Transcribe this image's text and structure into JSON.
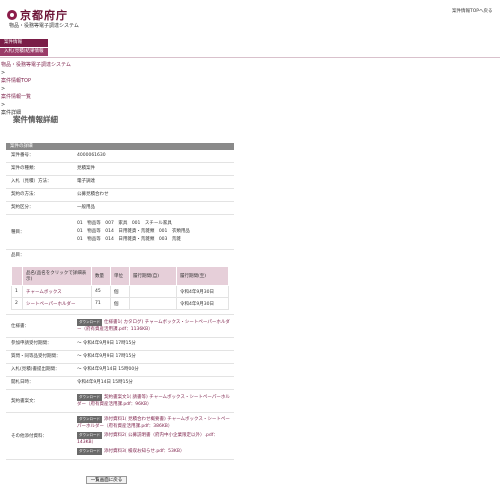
{
  "header": {
    "logo": "京都府庁",
    "subtitle": "物品・役務等電子調達システム",
    "top_link": "案件情報TOPへ戻る"
  },
  "nav": {
    "items": [
      "案件情報",
      "入札(見積)結果情報"
    ]
  },
  "breadcrumbs": {
    "system": "物品・役務等電子調達システム",
    "sep": ">",
    "top": "案件情報TOP",
    "list": "案件情報一覧",
    "current": "案件詳細"
  },
  "page_title": "案件情報詳細",
  "section_title": "案件の詳細",
  "fields": {
    "number": {
      "label": "案件番号：",
      "value": "4000061630"
    },
    "type": {
      "label": "案件の種類：",
      "value": "見積案件"
    },
    "method": {
      "label": "入札（見積）方法：",
      "value": "電子調達"
    },
    "contract": {
      "label": "契約の方法：",
      "value": "公募見積合わせ"
    },
    "category": {
      "label": "契約区分：",
      "value": "一般用品"
    },
    "kind": {
      "label": "種目：",
      "values": [
        "01　物品等　007　家具　001　スチール家具",
        "01　物品等　014　日用雑貨・荒雑類　001　衣類用品",
        "01　物品等　014　日用雑貨・荒雑類　003　荒雑"
      ]
    },
    "items_label": "品目："
  },
  "items_table": {
    "headers": [
      "",
      "品名(品名をクリックで詳細表示)",
      "数量",
      "単位",
      "履行期間(自)",
      "履行期間(至)"
    ],
    "rows": [
      [
        "1",
        "チャームボックス",
        "45",
        "個",
        "",
        "令和4年9月30日"
      ],
      [
        "2",
        "シートペーパーホルダー",
        "71",
        "個",
        "",
        "令和4年9月30日"
      ]
    ]
  },
  "spec": {
    "label": "仕様書：",
    "badge": "ダウンロード",
    "file": "仕様書1( カタログ) チャームボックス・シートペーパーホルダー（府有資産活用課.pdf：1136KB）"
  },
  "dates": [
    {
      "label": "参加申請受付期間：",
      "value": "～ 令和4年9月9日 17時15分"
    },
    {
      "label": "質問・同等品受付期間：",
      "value": "～ 令和4年9月9日 17時15分"
    },
    {
      "label": "入札(見積)書提出期間：",
      "value": "～ 令和4年9月14日 15時00分"
    },
    {
      "label": "開札日時：",
      "value": "令和4年9月14日 15時15分"
    }
  ],
  "contract_doc": {
    "label": "契約書案文：",
    "badge": "ダウンロード",
    "file": "契約書案文1( 請書等) チャームボックス・シートペーパーホルダー（府有資産活用課.pdf：96KB）"
  },
  "other_docs": {
    "label": "その他添付資料：",
    "badge": "ダウンロード",
    "files": [
      "添付資料1( 見積合わせ概要書) チャームボックス・シートペーパーホルダー（府有資産活用課.pdf：386KB）",
      "添付資料2( 公募説明書（府内中小企業限定以外）.pdf：143KB）",
      "添付資料3( 検収お知らせ.pdf：53KB）"
    ]
  },
  "back_button": "一覧画面に戻る",
  "colors": {
    "accent": "#7a1d47",
    "header_gray": "#8a8a8a",
    "table_head": "#e6cfd9"
  }
}
